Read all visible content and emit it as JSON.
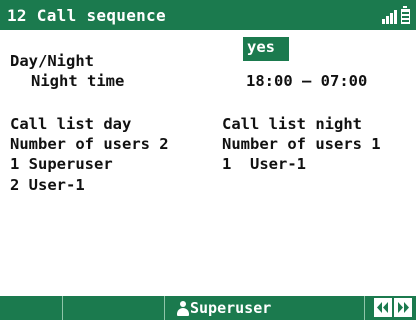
{
  "header": {
    "title": "12 Call sequence",
    "signal_icon": "signal-strength-icon",
    "battery_icon": "battery-icon"
  },
  "settings": {
    "day_night_label": "Day/Night",
    "day_night_value": "yes",
    "night_time_label": "Night time",
    "night_time_value": "18:00 – 07:00"
  },
  "call_list_day": {
    "heading": "Call list day",
    "count_label": "Number of users 2",
    "users": [
      "1 Superuser",
      "2 User-1"
    ]
  },
  "call_list_night": {
    "heading": "Call list night",
    "count_label": "Number of users 1",
    "users": [
      "1  User-1"
    ]
  },
  "taskbar": {
    "current_user": "Superuser",
    "user_icon": "person-icon",
    "nav_icons": [
      "left-arrow-icon",
      "right-arrow-icon"
    ]
  },
  "colors": {
    "primary": "#1b7a4e",
    "text": "#111111",
    "background": "#ffffff"
  }
}
